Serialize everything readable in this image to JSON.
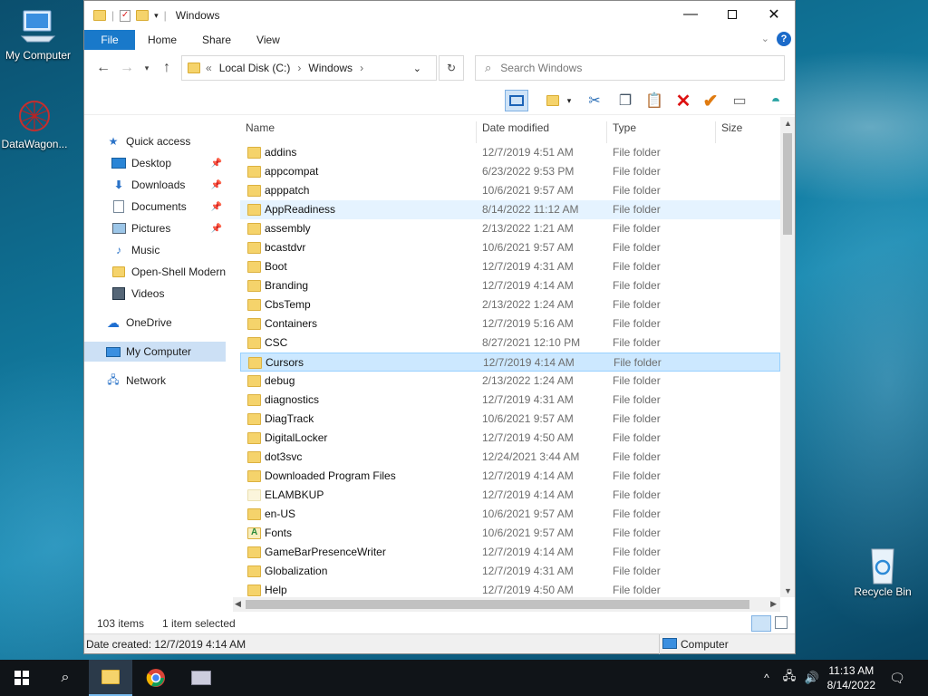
{
  "desktop": {
    "icons": [
      {
        "label": "My Computer"
      },
      {
        "label": "DataWagon..."
      },
      {
        "label": "Recycle Bin"
      }
    ]
  },
  "window": {
    "title": "Windows",
    "controls": [
      "minimize",
      "maximize",
      "close"
    ]
  },
  "ribbon": {
    "tabs": [
      "File",
      "Home",
      "Share",
      "View"
    ]
  },
  "address": {
    "parts": [
      "Local Disk (C:)",
      "Windows"
    ],
    "separator": "›",
    "prefix": "«"
  },
  "search": {
    "placeholder": "Search Windows"
  },
  "nav": {
    "items": [
      {
        "label": "Quick access",
        "icon": "star-icon",
        "pin": false
      },
      {
        "label": "Desktop",
        "icon": "desktop-icon",
        "pin": true
      },
      {
        "label": "Downloads",
        "icon": "download-icon",
        "pin": true
      },
      {
        "label": "Documents",
        "icon": "documents-icon",
        "pin": true
      },
      {
        "label": "Pictures",
        "icon": "pictures-icon",
        "pin": true
      },
      {
        "label": "Music",
        "icon": "music-icon",
        "pin": false
      },
      {
        "label": "Open-Shell Modern",
        "icon": "folder-icon",
        "pin": false
      },
      {
        "label": "Videos",
        "icon": "videos-icon",
        "pin": false
      },
      {
        "label": "OneDrive",
        "icon": "cloud-icon",
        "pin": false
      },
      {
        "label": "My Computer",
        "icon": "computer-icon",
        "pin": false
      },
      {
        "label": "Network",
        "icon": "network-icon",
        "pin": false
      }
    ]
  },
  "columns": {
    "name": "Name",
    "date": "Date modified",
    "type": "Type",
    "size": "Size"
  },
  "files": [
    {
      "name": "addins",
      "date": "12/7/2019 4:51 AM",
      "type": "File folder"
    },
    {
      "name": "appcompat",
      "date": "6/23/2022 9:53 PM",
      "type": "File folder"
    },
    {
      "name": "apppatch",
      "date": "10/6/2021 9:57 AM",
      "type": "File folder"
    },
    {
      "name": "AppReadiness",
      "date": "8/14/2022 11:12 AM",
      "type": "File folder"
    },
    {
      "name": "assembly",
      "date": "2/13/2022 1:21 AM",
      "type": "File folder"
    },
    {
      "name": "bcastdvr",
      "date": "10/6/2021 9:57 AM",
      "type": "File folder"
    },
    {
      "name": "Boot",
      "date": "12/7/2019 4:31 AM",
      "type": "File folder"
    },
    {
      "name": "Branding",
      "date": "12/7/2019 4:14 AM",
      "type": "File folder"
    },
    {
      "name": "CbsTemp",
      "date": "2/13/2022 1:24 AM",
      "type": "File folder"
    },
    {
      "name": "Containers",
      "date": "12/7/2019 5:16 AM",
      "type": "File folder"
    },
    {
      "name": "CSC",
      "date": "8/27/2021 12:10 PM",
      "type": "File folder"
    },
    {
      "name": "Cursors",
      "date": "12/7/2019 4:14 AM",
      "type": "File folder"
    },
    {
      "name": "debug",
      "date": "2/13/2022 1:24 AM",
      "type": "File folder"
    },
    {
      "name": "diagnostics",
      "date": "12/7/2019 4:31 AM",
      "type": "File folder"
    },
    {
      "name": "DiagTrack",
      "date": "10/6/2021 9:57 AM",
      "type": "File folder"
    },
    {
      "name": "DigitalLocker",
      "date": "12/7/2019 4:50 AM",
      "type": "File folder"
    },
    {
      "name": "dot3svc",
      "date": "12/24/2021 3:44 AM",
      "type": "File folder"
    },
    {
      "name": "Downloaded Program Files",
      "date": "12/7/2019 4:14 AM",
      "type": "File folder"
    },
    {
      "name": "ELAMBKUP",
      "date": "12/7/2019 4:14 AM",
      "type": "File folder"
    },
    {
      "name": "en-US",
      "date": "10/6/2021 9:57 AM",
      "type": "File folder"
    },
    {
      "name": "Fonts",
      "date": "10/6/2021 9:57 AM",
      "type": "File folder"
    },
    {
      "name": "GameBarPresenceWriter",
      "date": "12/7/2019 4:14 AM",
      "type": "File folder"
    },
    {
      "name": "Globalization",
      "date": "12/7/2019 4:31 AM",
      "type": "File folder"
    },
    {
      "name": "Help",
      "date": "12/7/2019 4:50 AM",
      "type": "File folder"
    }
  ],
  "selected_index": 11,
  "hover_index": 3,
  "status": {
    "count": "103 items",
    "selected": "1 item selected"
  },
  "details": {
    "left": "Date created: 12/7/2019 4:14 AM",
    "right": "Computer"
  },
  "clock": {
    "time": "11:13 AM",
    "date": "8/14/2022"
  }
}
